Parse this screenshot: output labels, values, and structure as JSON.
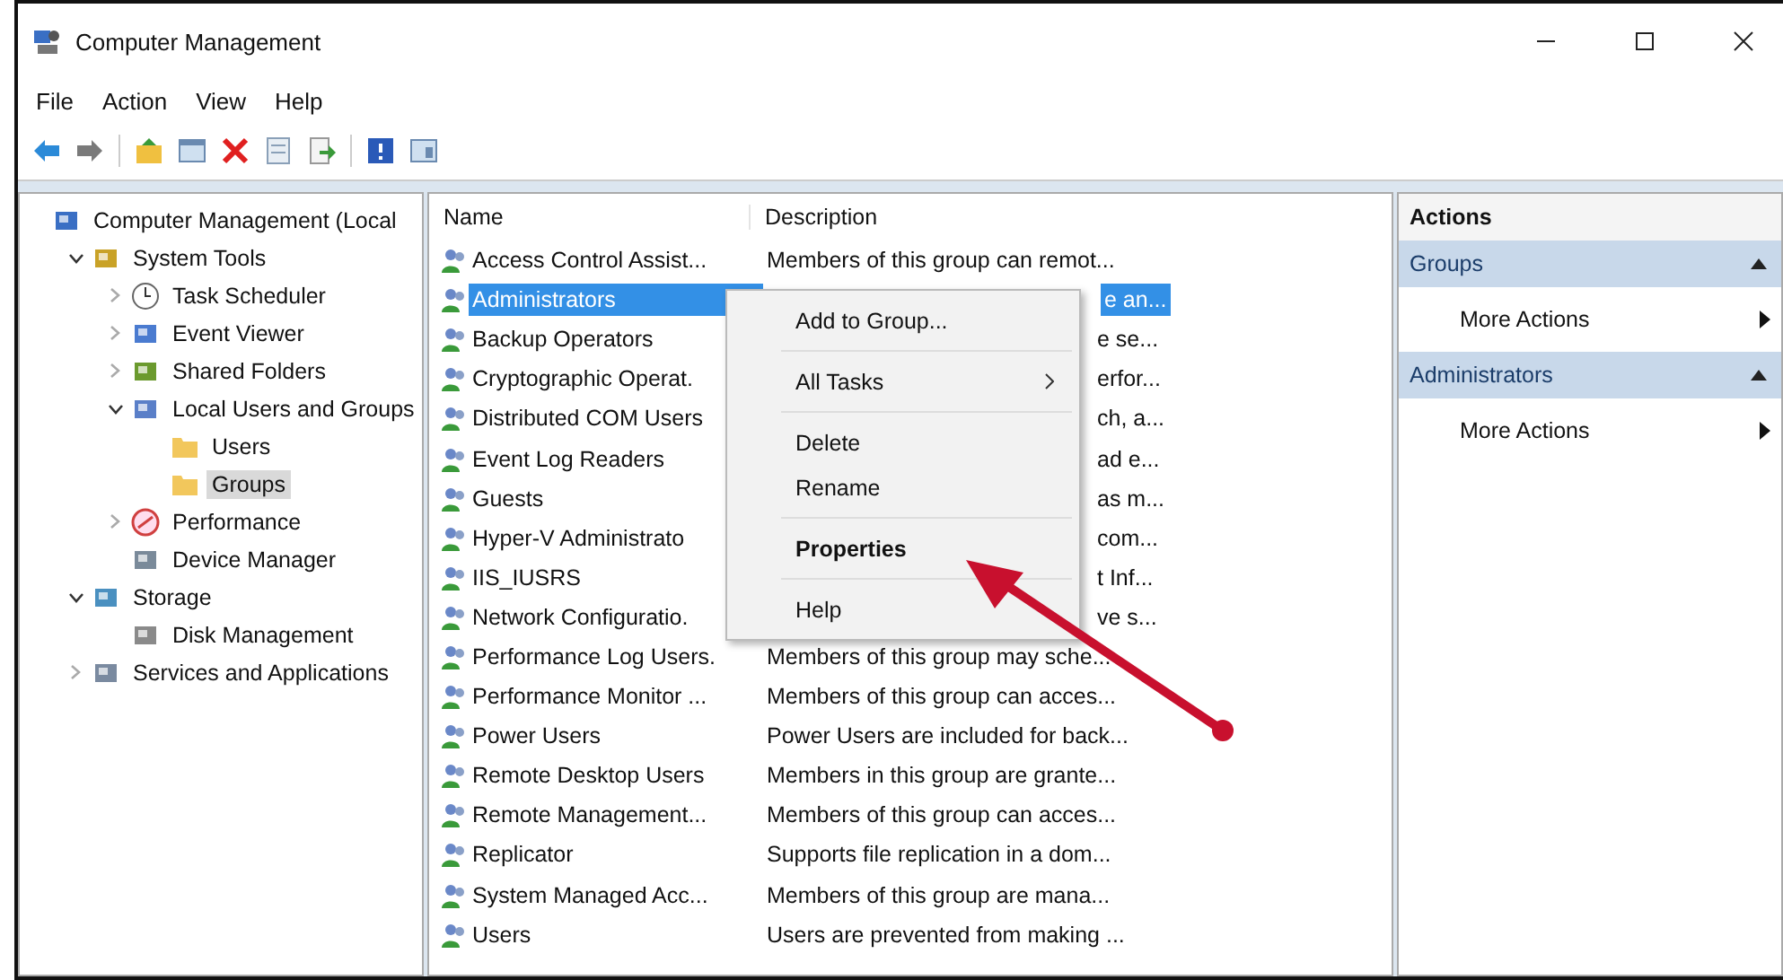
{
  "window": {
    "title": "Computer Management"
  },
  "menu": [
    "File",
    "Action",
    "View",
    "Help"
  ],
  "tree": [
    {
      "label": "Computer Management (Local",
      "kind": "computer",
      "selected": false,
      "children": [
        {
          "label": "System Tools",
          "kind": "tools",
          "expanded": true,
          "selected": false,
          "children": [
            {
              "label": "Task Scheduler",
              "kind": "clock",
              "expanded": false,
              "selected": false
            },
            {
              "label": "Event Viewer",
              "kind": "viewer",
              "expanded": false,
              "selected": false
            },
            {
              "label": "Shared Folders",
              "kind": "share",
              "expanded": false,
              "selected": false
            },
            {
              "label": "Local Users and Groups",
              "kind": "users",
              "expanded": true,
              "selected": false,
              "children": [
                {
                  "label": "Users",
                  "kind": "folder",
                  "selected": false
                },
                {
                  "label": "Groups",
                  "kind": "folder",
                  "selected": true
                }
              ]
            },
            {
              "label": "Performance",
              "kind": "perf",
              "expanded": false,
              "selected": false
            },
            {
              "label": "Device Manager",
              "kind": "device",
              "selected": false
            }
          ]
        },
        {
          "label": "Storage",
          "kind": "storage",
          "expanded": true,
          "selected": false,
          "children": [
            {
              "label": "Disk Management",
              "kind": "disk",
              "selected": false
            }
          ]
        },
        {
          "label": "Services and Applications",
          "kind": "services",
          "expanded": false,
          "selected": false
        }
      ]
    }
  ],
  "table": {
    "columns": [
      "Name",
      "Description"
    ],
    "rows": [
      {
        "name": "Access Control Assist...",
        "description": "Members of this group can remot...",
        "covered": false,
        "selected": false
      },
      {
        "name": "Administrators",
        "description": "e an...",
        "covered": true,
        "selected": true
      },
      {
        "name": "Backup Operators",
        "description": "e se...",
        "covered": true,
        "selected": false
      },
      {
        "name": "Cryptographic Operat.",
        "description": "erfor...",
        "covered": true,
        "selected": false
      },
      {
        "name": "Distributed COM Users",
        "description": "ch, a...",
        "covered": true,
        "selected": false
      },
      {
        "name": "Event Log Readers",
        "description": "ad e...",
        "covered": true,
        "selected": false
      },
      {
        "name": "Guests",
        "description": "as m...",
        "covered": true,
        "selected": false
      },
      {
        "name": "Hyper-V Administrato",
        "description": "com...",
        "covered": true,
        "selected": false
      },
      {
        "name": "IIS_IUSRS",
        "description": "t Inf...",
        "covered": true,
        "selected": false
      },
      {
        "name": "Network Configuratio.",
        "description": "ve s...",
        "covered": true,
        "selected": false
      },
      {
        "name": "Performance Log Users.",
        "description": "Members of this group may sche...",
        "covered": false,
        "selected": false
      },
      {
        "name": "Performance Monitor ...",
        "description": "Members of this group can acces...",
        "covered": false,
        "selected": false
      },
      {
        "name": "Power Users",
        "description": "Power Users are included for back...",
        "covered": false,
        "selected": false
      },
      {
        "name": "Remote Desktop Users",
        "description": "Members in this group are grante...",
        "covered": false,
        "selected": false
      },
      {
        "name": "Remote Management...",
        "description": "Members of this group can acces...",
        "covered": false,
        "selected": false
      },
      {
        "name": "Replicator",
        "description": "Supports file replication in a dom...",
        "covered": false,
        "selected": false
      },
      {
        "name": "System Managed Acc...",
        "description": "Members of this group are mana...",
        "covered": false,
        "selected": false
      },
      {
        "name": "Users",
        "description": "Users are prevented from making ...",
        "covered": false,
        "selected": false
      }
    ]
  },
  "context_menu": [
    {
      "kind": "item",
      "label": "Add to Group...",
      "default": false,
      "submenu": false
    },
    {
      "kind": "separator"
    },
    {
      "kind": "item",
      "label": "All Tasks",
      "default": false,
      "submenu": true
    },
    {
      "kind": "separator"
    },
    {
      "kind": "item",
      "label": "Delete",
      "default": false,
      "submenu": false
    },
    {
      "kind": "item",
      "label": "Rename",
      "default": false,
      "submenu": false
    },
    {
      "kind": "separator"
    },
    {
      "kind": "item",
      "label": "Properties",
      "default": true,
      "submenu": false
    },
    {
      "kind": "separator"
    },
    {
      "kind": "item",
      "label": "Help",
      "default": false,
      "submenu": false
    }
  ],
  "actions": {
    "title": "Actions",
    "sections": [
      {
        "title": "Groups",
        "expanded": true,
        "items": [
          "More Actions"
        ]
      },
      {
        "title": "Administrators",
        "expanded": true,
        "items": [
          "More Actions"
        ]
      }
    ]
  }
}
